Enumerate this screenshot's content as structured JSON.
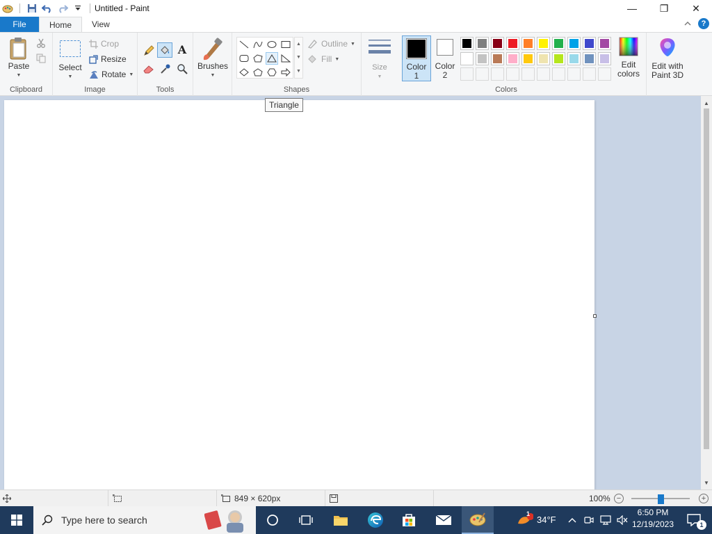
{
  "window": {
    "title": "Untitled - Paint",
    "minimize": "—",
    "maximize": "❐",
    "close": "✕"
  },
  "menu": {
    "file": "File",
    "tabs": [
      "Home",
      "View"
    ]
  },
  "ribbon": {
    "clipboard": {
      "label": "Clipboard",
      "paste": "Paste"
    },
    "image": {
      "label": "Image",
      "select": "Select",
      "crop": "Crop",
      "resize": "Resize",
      "rotate": "Rotate"
    },
    "tools": {
      "label": "Tools"
    },
    "brushes": {
      "label": "Brushes"
    },
    "shapes": {
      "label": "Shapes",
      "outline": "Outline",
      "fill": "Fill"
    },
    "size": {
      "label": "Size"
    },
    "colors": {
      "label": "Colors",
      "color1": "Color",
      "color1_num": "1",
      "color2": "Color",
      "color2_num": "2",
      "edit_colors": "Edit",
      "edit_colors2": "colors",
      "paint3d": "Edit with",
      "paint3d2": "Paint 3D",
      "color1_value": "#000000",
      "color2_value": "#ffffff",
      "palette_row1": [
        "#000000",
        "#7f7f7f",
        "#880015",
        "#ed1c24",
        "#ff7f27",
        "#fff200",
        "#22b14c",
        "#00a2e8",
        "#3f48cc",
        "#a349a4"
      ],
      "palette_row2": [
        "#ffffff",
        "#c3c3c3",
        "#b97a57",
        "#ffaec9",
        "#ffc90e",
        "#efe4b0",
        "#b5e61d",
        "#99d9ea",
        "#7092be",
        "#c8bfe7"
      ]
    }
  },
  "tooltip": "Triangle",
  "status": {
    "canvas_size": "849 × 620px",
    "zoom": "100%"
  },
  "taskbar": {
    "search_placeholder": "Type here to search",
    "weather": "34°F",
    "weather_badge": "1",
    "time": "6:50 PM",
    "date": "12/19/2023",
    "notif_count": "1"
  }
}
